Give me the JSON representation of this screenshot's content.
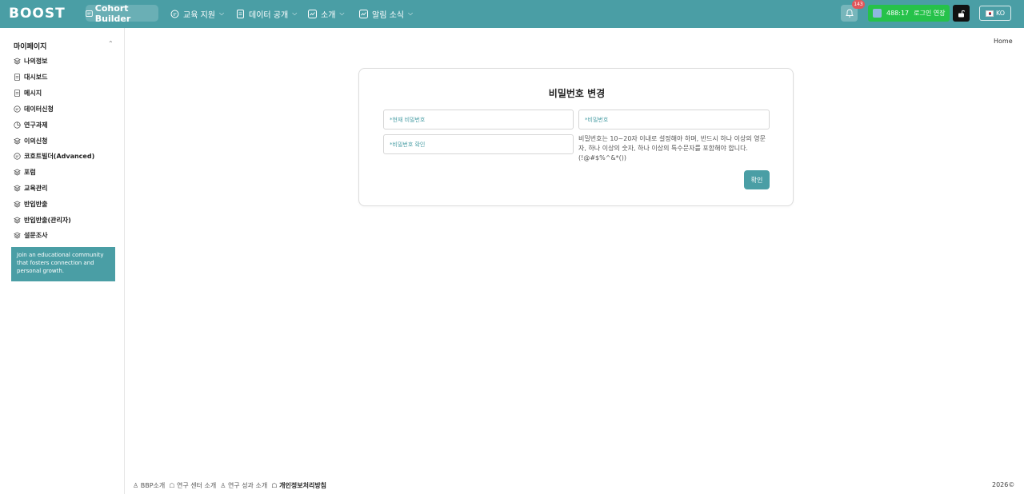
{
  "header": {
    "logo_text": "BOOST",
    "cohort_builder": "Cohort Builder",
    "nav": [
      {
        "label": "교육 지원"
      },
      {
        "label": "데이터 공개"
      },
      {
        "label": "소개"
      },
      {
        "label": "알림 소식"
      }
    ],
    "notification_count": "143",
    "session_timer": "488:17",
    "session_extend": "로그인 연장",
    "language": "KO"
  },
  "sidebar": {
    "title": "마이페이지",
    "items": [
      {
        "label": "나의정보",
        "icon": "layers-icon"
      },
      {
        "label": "대시보드",
        "icon": "document-icon"
      },
      {
        "label": "메시지",
        "icon": "document-icon"
      },
      {
        "label": "데이터신청",
        "icon": "message-icon"
      },
      {
        "label": "연구과제",
        "icon": "chart-icon"
      },
      {
        "label": "이의신청",
        "icon": "layers-icon"
      },
      {
        "label": "코호트빌더(Advanced)",
        "icon": "message-icon"
      },
      {
        "label": "포럼",
        "icon": "layers-icon"
      },
      {
        "label": "교육관리",
        "icon": "layers-icon"
      },
      {
        "label": "반입반출",
        "icon": "layers-icon"
      },
      {
        "label": "반입반출(관리자)",
        "icon": "layers-icon"
      },
      {
        "label": "설문조사",
        "icon": "layers-icon"
      }
    ],
    "promo_text": "Join an educational community that fosters connection and personal growth."
  },
  "breadcrumb": "Home",
  "form": {
    "title": "비밀번호 변경",
    "current_password_placeholder": "*현재 비밀번호",
    "new_password_placeholder": "*비밀번호",
    "confirm_password_placeholder": "*비밀번호 확인",
    "help_text": "비밀번호는 10~20자 이내로 설정해야 하며, 반드시 하나 이상의 영문자, 하나 이상의 숫자, 하나 이상의 특수문자를 포함해야 합니다.(!@#$%^&*())",
    "confirm_label": "확인"
  },
  "footer": {
    "links": [
      "BBP소개",
      "연구 센터 소개",
      "연구 성과 소개",
      "개인정보처리방침"
    ],
    "copyright": "2026©"
  },
  "colors": {
    "primary": "#4a9ea5",
    "session": "#26c24a",
    "badge": "#e0565b"
  }
}
